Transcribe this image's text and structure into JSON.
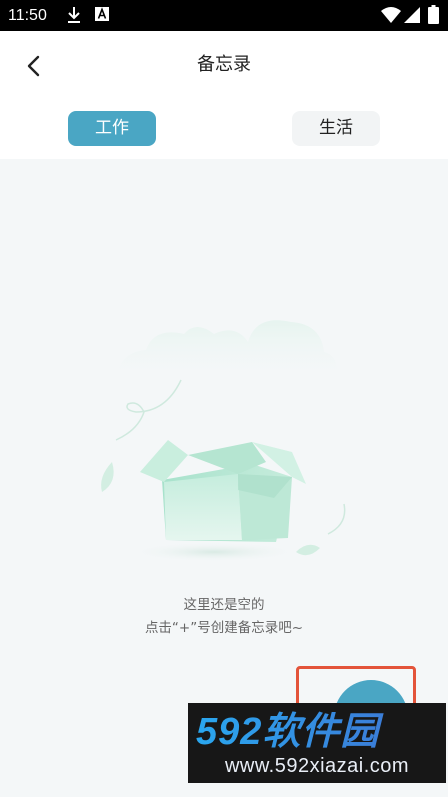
{
  "status_bar": {
    "time": "11:50",
    "icons": [
      "download-icon",
      "a-letter-icon",
      "wifi-icon",
      "signal-icon",
      "battery-icon"
    ]
  },
  "header": {
    "title": "备忘录",
    "back_icon": "chevron-left-icon"
  },
  "tabs": [
    {
      "label": "工作",
      "active": true
    },
    {
      "label": "生活",
      "active": false
    }
  ],
  "empty_state": {
    "line1": "这里还是空的",
    "line2": "点击“+”号创建备忘录吧~"
  },
  "fab": {
    "icon": "plus-icon"
  },
  "watermark": {
    "logo_text": "592软件园",
    "url": "www.592xiazai.com"
  },
  "colors": {
    "accent": "#4aa6c4",
    "highlight_border": "#e3543a",
    "background": "#f4f7f8"
  }
}
